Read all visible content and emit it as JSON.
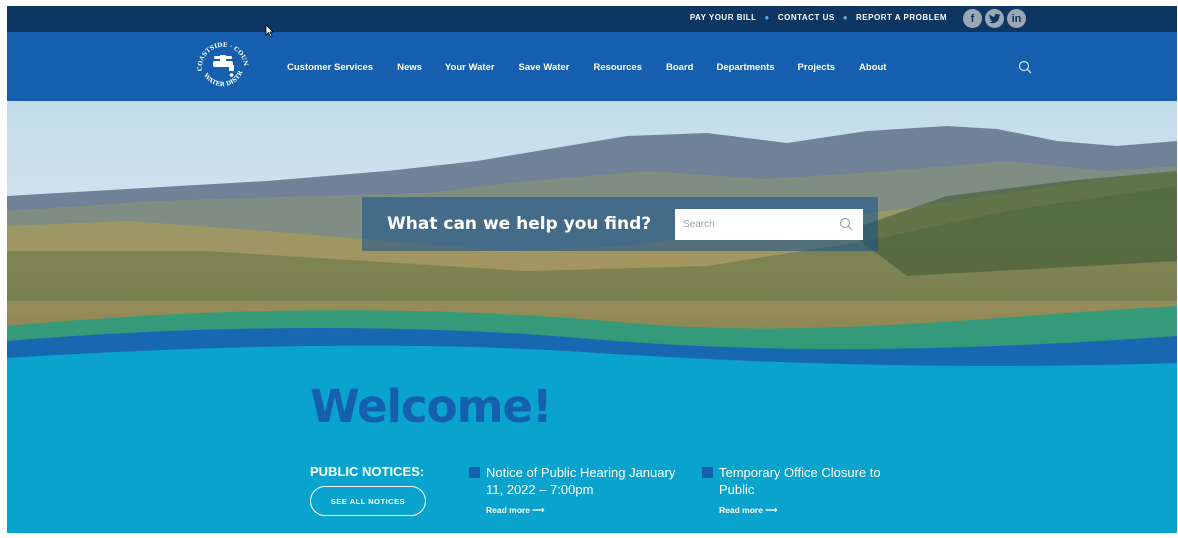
{
  "topbar": {
    "links": [
      "PAY YOUR BILL",
      "CONTACT US",
      "REPORT A PROBLEM"
    ],
    "social": [
      "f",
      "t",
      "in"
    ]
  },
  "logo": {
    "text": "COASTSIDE COUNTY WATER DISTRICT"
  },
  "nav": {
    "items": [
      "Customer Services",
      "News",
      "Your Water",
      "Save Water",
      "Resources",
      "Board",
      "Departments",
      "Projects",
      "About"
    ]
  },
  "hero": {
    "prompt": "What can we help you find?",
    "search_placeholder": "Search"
  },
  "main": {
    "welcome": "Welcome!",
    "notices_label": "PUBLIC NOTICES:",
    "see_all_label": "SEE ALL NOTICES",
    "notices": [
      {
        "title": "Notice of Public Hearing January 11, 2022 – 7:00pm",
        "more": "Read more ⟶"
      },
      {
        "title": "Temporary Office Closure to Public",
        "more": "Read more ⟶"
      }
    ]
  },
  "colors": {
    "topbar": "#0e3663",
    "nav": "#155fae",
    "water": "#0aa3cd",
    "accent": "#155fae"
  }
}
